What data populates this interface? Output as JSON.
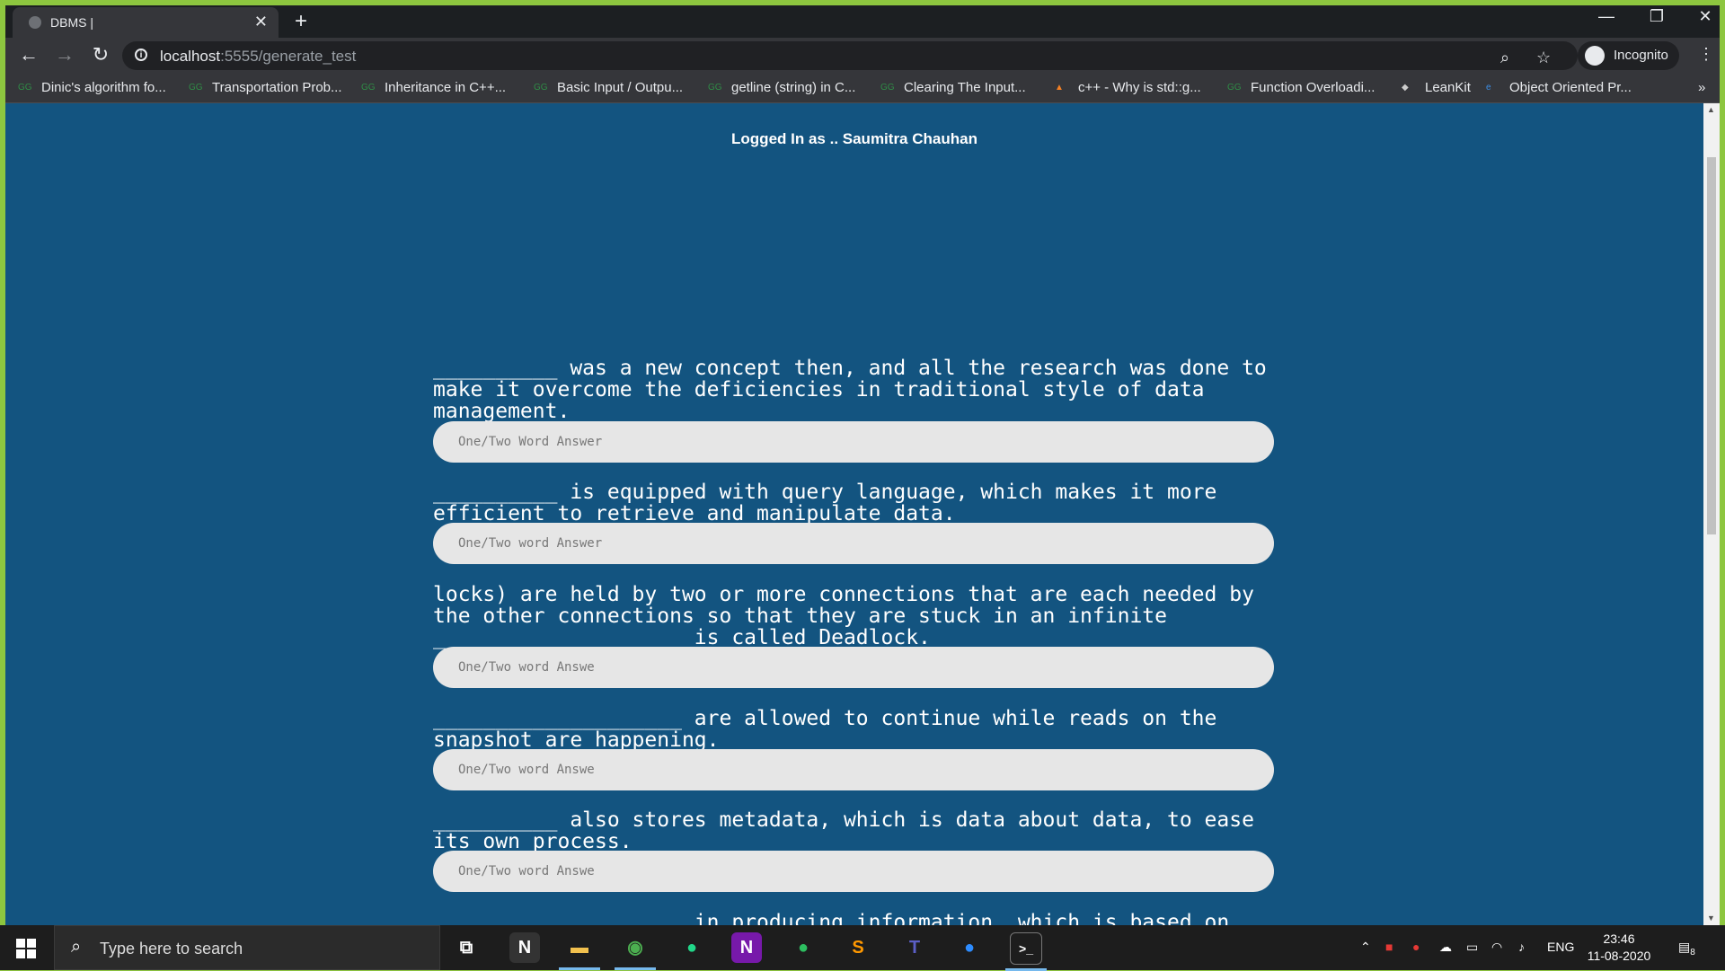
{
  "browser": {
    "tab_title": "DBMS |",
    "url_host": "localhost",
    "url_rest": ":5555/generate_test",
    "profile_label": "Incognito",
    "bookmarks": [
      "Dinic's algorithm fo...",
      "Transportation Prob...",
      "Inheritance in C++...",
      "Basic Input / Outpu...",
      "getline (string) in C...",
      "Clearing The Input...",
      "c++ - Why is std::g...",
      "Function Overloadi...",
      "LeanKit",
      "Object Oriented Pr..."
    ],
    "bookmarks_more": "»"
  },
  "page": {
    "logged_in_text": "Logged In as .. Saumitra Chauhan",
    "questions": [
      {
        "text": "__________ was a new concept then, and all the research was done to make it overcome the deficiencies in traditional style of data management.",
        "placeholder": "One/Two Word Answer"
      },
      {
        "text": "__________ is equipped with query language, which makes it more efficient to retrieve and manipulate data.",
        "placeholder": "One/Two word Answer"
      },
      {
        "text": "locks) are held by two or more connections that are each needed by the other connections so that they are stuck in an infinite ____________________ is called Deadlock.",
        "placeholder": "One/Two word Answe"
      },
      {
        "text": "____________________ are allowed to continue while reads on the snapshot are happening.",
        "placeholder": "One/Two word Answe"
      },
      {
        "text": "__________ also stores metadata, which is data about data, to ease its own process.",
        "placeholder": "One/Two word Answe"
      },
      {
        "text": "____________________ in producing information, which is based on",
        "placeholder": ""
      }
    ]
  },
  "taskbar": {
    "search_placeholder": "Type here to search",
    "tray_language": "ENG",
    "time": "23:46",
    "date": "11-08-2020",
    "notification_count": "8"
  }
}
